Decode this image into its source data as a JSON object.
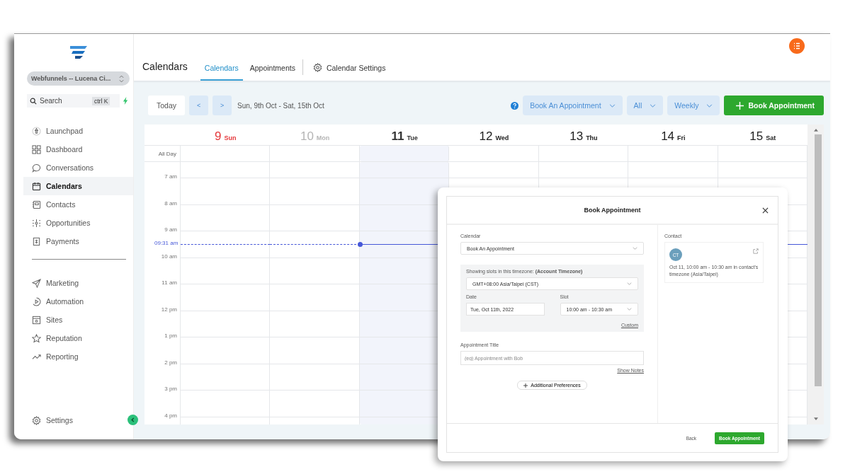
{
  "sidebar": {
    "account": "Webfunnels -- Lucena Ci...",
    "search": {
      "placeholder": "Search",
      "shortcut": "ctrl K"
    },
    "groups": [
      [
        {
          "label": "Launchpad",
          "selected": false
        },
        {
          "label": "Dashboard",
          "selected": false
        },
        {
          "label": "Conversations",
          "selected": false
        },
        {
          "label": "Calendars",
          "selected": true
        },
        {
          "label": "Contacts",
          "selected": false
        },
        {
          "label": "Opportunities",
          "selected": false
        },
        {
          "label": "Payments",
          "selected": false
        }
      ],
      [
        {
          "label": "Marketing",
          "selected": false
        },
        {
          "label": "Automation",
          "selected": false
        },
        {
          "label": "Sites",
          "selected": false
        },
        {
          "label": "Reputation",
          "selected": false
        },
        {
          "label": "Reporting",
          "selected": false
        }
      ]
    ],
    "settings": "Settings"
  },
  "header": {
    "title": "Calendars",
    "tabs": [
      {
        "label": "Calendars",
        "selected": true
      },
      {
        "label": "Appointments",
        "selected": false
      }
    ],
    "settings_link": "Calendar Settings"
  },
  "toolbar": {
    "today": "Today",
    "prev": "<",
    "next": ">",
    "range": "Sun, 9th Oct - Sat, 15th Oct",
    "dropdowns": [
      "Book An Appointment",
      "All",
      "Weekly"
    ],
    "book_button": "Book Appointment"
  },
  "calendar": {
    "days": [
      {
        "num": "9",
        "name": "Sun",
        "kind": "sunday"
      },
      {
        "num": "10",
        "name": "Mon",
        "kind": "past"
      },
      {
        "num": "11",
        "name": "Tue",
        "kind": "today"
      },
      {
        "num": "12",
        "name": "Wed",
        "kind": "normal"
      },
      {
        "num": "13",
        "name": "Thu",
        "kind": "normal"
      },
      {
        "num": "14",
        "name": "Fri",
        "kind": "normal"
      },
      {
        "num": "15",
        "name": "Sat",
        "kind": "normal"
      }
    ],
    "all_day": "All Day",
    "hours": [
      "7 am",
      "8 am",
      "9 am",
      "10 am",
      "11 am",
      "12 pm",
      "1 pm",
      "2 pm",
      "3 pm",
      "4 pm"
    ],
    "now": "09:31 am"
  },
  "modal": {
    "title": "Book Appointment",
    "calendar": {
      "label": "Calendar",
      "value": "Book An Appointment"
    },
    "timezone": {
      "label": "Showing slots in this timezone: **(Account Timezone)**",
      "value": "GMT+08:00 Asia/Taipei (CST)"
    },
    "date": {
      "label": "Date",
      "value": "Tue, Oct 11th, 2022"
    },
    "slot": {
      "label": "Slot",
      "value": "10:00 am - 10:30 am"
    },
    "custom": "Custom",
    "appointment_title": {
      "label": "Appointment Title",
      "placeholder": "(eg) Appointment with Bob"
    },
    "show_notes": "Show Notes",
    "additional": "Additional Preferences",
    "contact": {
      "label": "Contact",
      "initials": "CT",
      "text": "Oct 11, 10:00 am - 10:30 am in contact's timezone (Asia/Taipei)"
    },
    "back": "Back",
    "submit": "Book Appointment"
  }
}
